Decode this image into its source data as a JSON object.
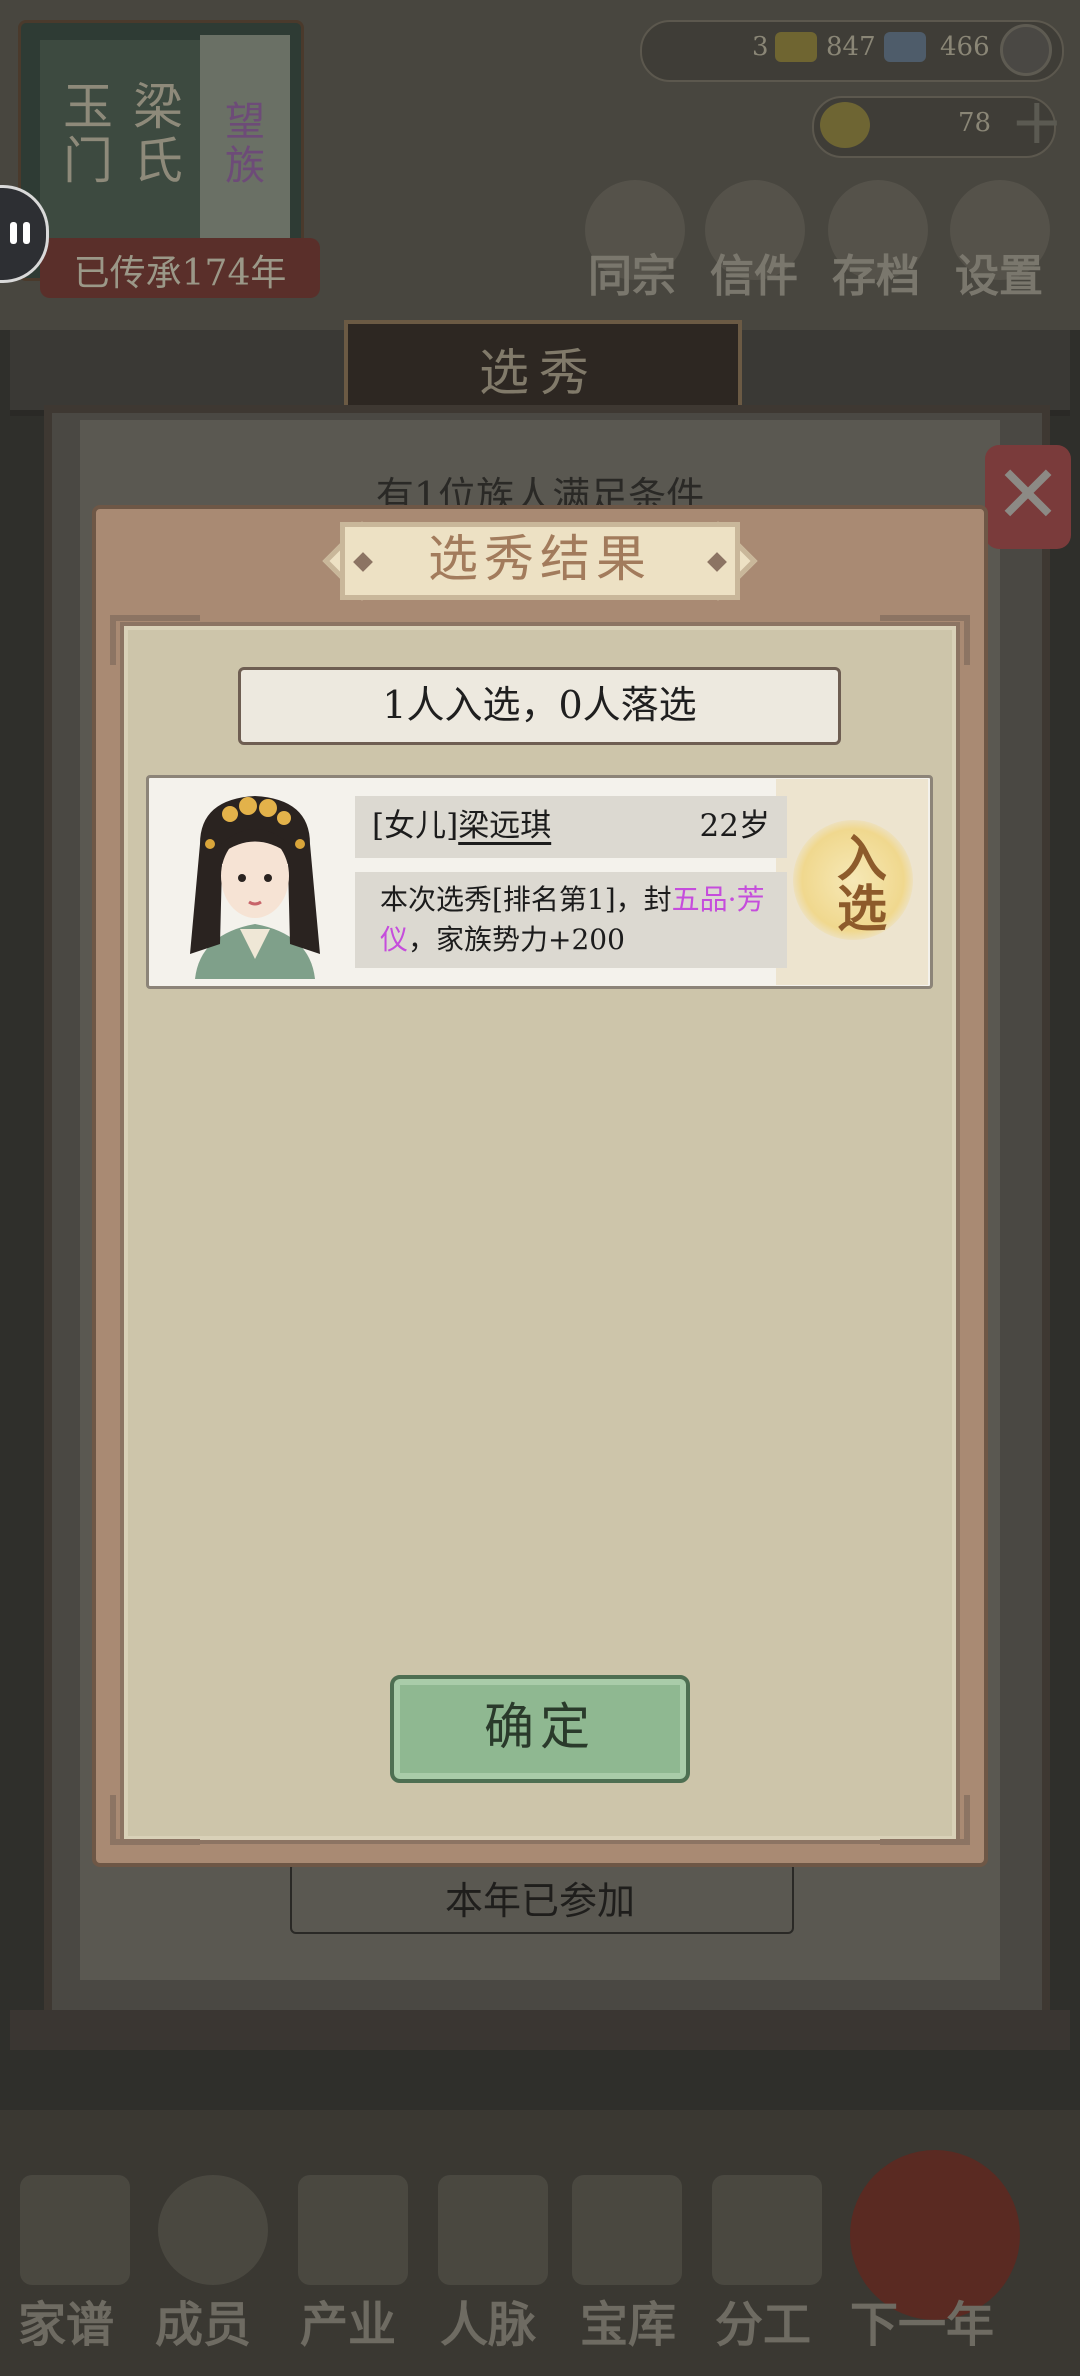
{
  "header": {
    "family_name_chars": [
      "玉",
      "门"
    ],
    "family_name_chars2": [
      "梁",
      "氏"
    ],
    "family_tag": "望族",
    "inherit_text": "已传承174年"
  },
  "resources": {
    "res1": "3",
    "res2": "847",
    "res3": "466",
    "ingot": "78"
  },
  "top_nav": [
    "同宗",
    "信件",
    "存档",
    "设置"
  ],
  "underlying_panel": {
    "title": "选秀",
    "eligible_text": "有1位族人满足条件",
    "joined_text": "本年已参加"
  },
  "modal": {
    "title": "选秀结果",
    "summary": "1人入选，0人落选",
    "result": {
      "relation": "[女儿]",
      "name": "梁远琪",
      "age": "22岁",
      "desc_prefix": "本次选秀[排名第1]，封",
      "rank_title_a": "五品·",
      "rank_title_b": "芳仪",
      "desc_suffix": "，家族势力+200",
      "stamp": "入选"
    },
    "confirm_label": "确定"
  },
  "bottom_nav": [
    "家谱",
    "成员",
    "产业",
    "人脉",
    "宝库",
    "分工",
    "下一年"
  ]
}
